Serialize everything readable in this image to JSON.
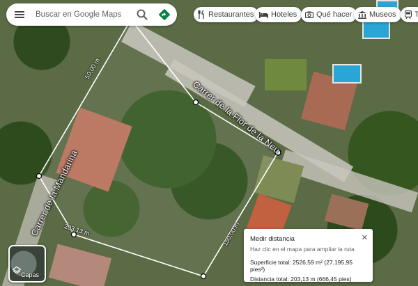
{
  "search": {
    "placeholder": "Buscar en Google Maps"
  },
  "chips": [
    {
      "label": "Restaurantes",
      "icon": "fork-knife-icon"
    },
    {
      "label": "Hoteles",
      "icon": "bed-icon"
    },
    {
      "label": "Qué hacer",
      "icon": "camera-icon"
    },
    {
      "label": "Museos",
      "icon": "museum-icon"
    },
    {
      "label": "T",
      "icon": "transit-icon"
    }
  ],
  "measure": {
    "segments": [
      "50,00 m",
      "203,13 m",
      "150,00 m"
    ]
  },
  "streets": [
    "Carrer de la Flor de la Neu",
    "Carrer de la Mandarina"
  ],
  "layers": {
    "label": "Capas"
  },
  "panel": {
    "title": "Medir distancia",
    "hint": "Haz clic en el mapa para ampliar la ruta",
    "area": "Superficie total: 2526,59 m² (27.195,95 pies²)",
    "distance": "Distancia total: 203,13 m (666,45 pies)"
  },
  "colors": {
    "measure_line": "#ffffff",
    "accent": "#1a73e8",
    "directions": "#0b8043"
  }
}
